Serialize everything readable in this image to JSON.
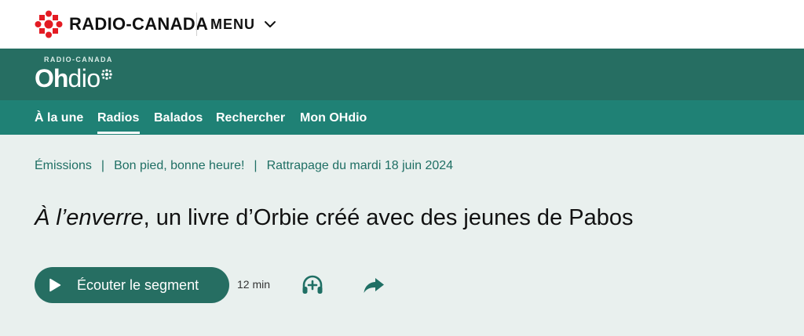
{
  "header": {
    "brand": "RADIO-CANADA",
    "menu_label": "MENU"
  },
  "ohdio": {
    "superscript": "RADIO-CANADA",
    "logo_bold": "Oh",
    "logo_light": "dio"
  },
  "nav": {
    "items": [
      {
        "label": "À la une"
      },
      {
        "label": "Radios",
        "active": true
      },
      {
        "label": "Balados"
      },
      {
        "label": "Rechercher"
      },
      {
        "label": "Mon OHdio"
      }
    ]
  },
  "breadcrumb": {
    "items": [
      "Émissions",
      "Bon pied, bonne heure!",
      "Rattrapage du mardi 18 juin 2024"
    ],
    "separator": "|"
  },
  "article": {
    "title_italic": "À l’enverre",
    "title_rest": ", un livre d’Orbie créé avec des jeunes de Pabos"
  },
  "player": {
    "listen_label": "Écouter le segment",
    "duration": "12 min"
  },
  "icons": {
    "add_to_playlist": "headphones-plus-icon",
    "share": "share-arrow-icon"
  },
  "colors": {
    "brand_red": "#e31b23",
    "ohdio_dark": "#266e62",
    "nav_teal": "#1f8175",
    "page_bg": "#e9f0ee",
    "link_teal": "#1f6f64"
  }
}
